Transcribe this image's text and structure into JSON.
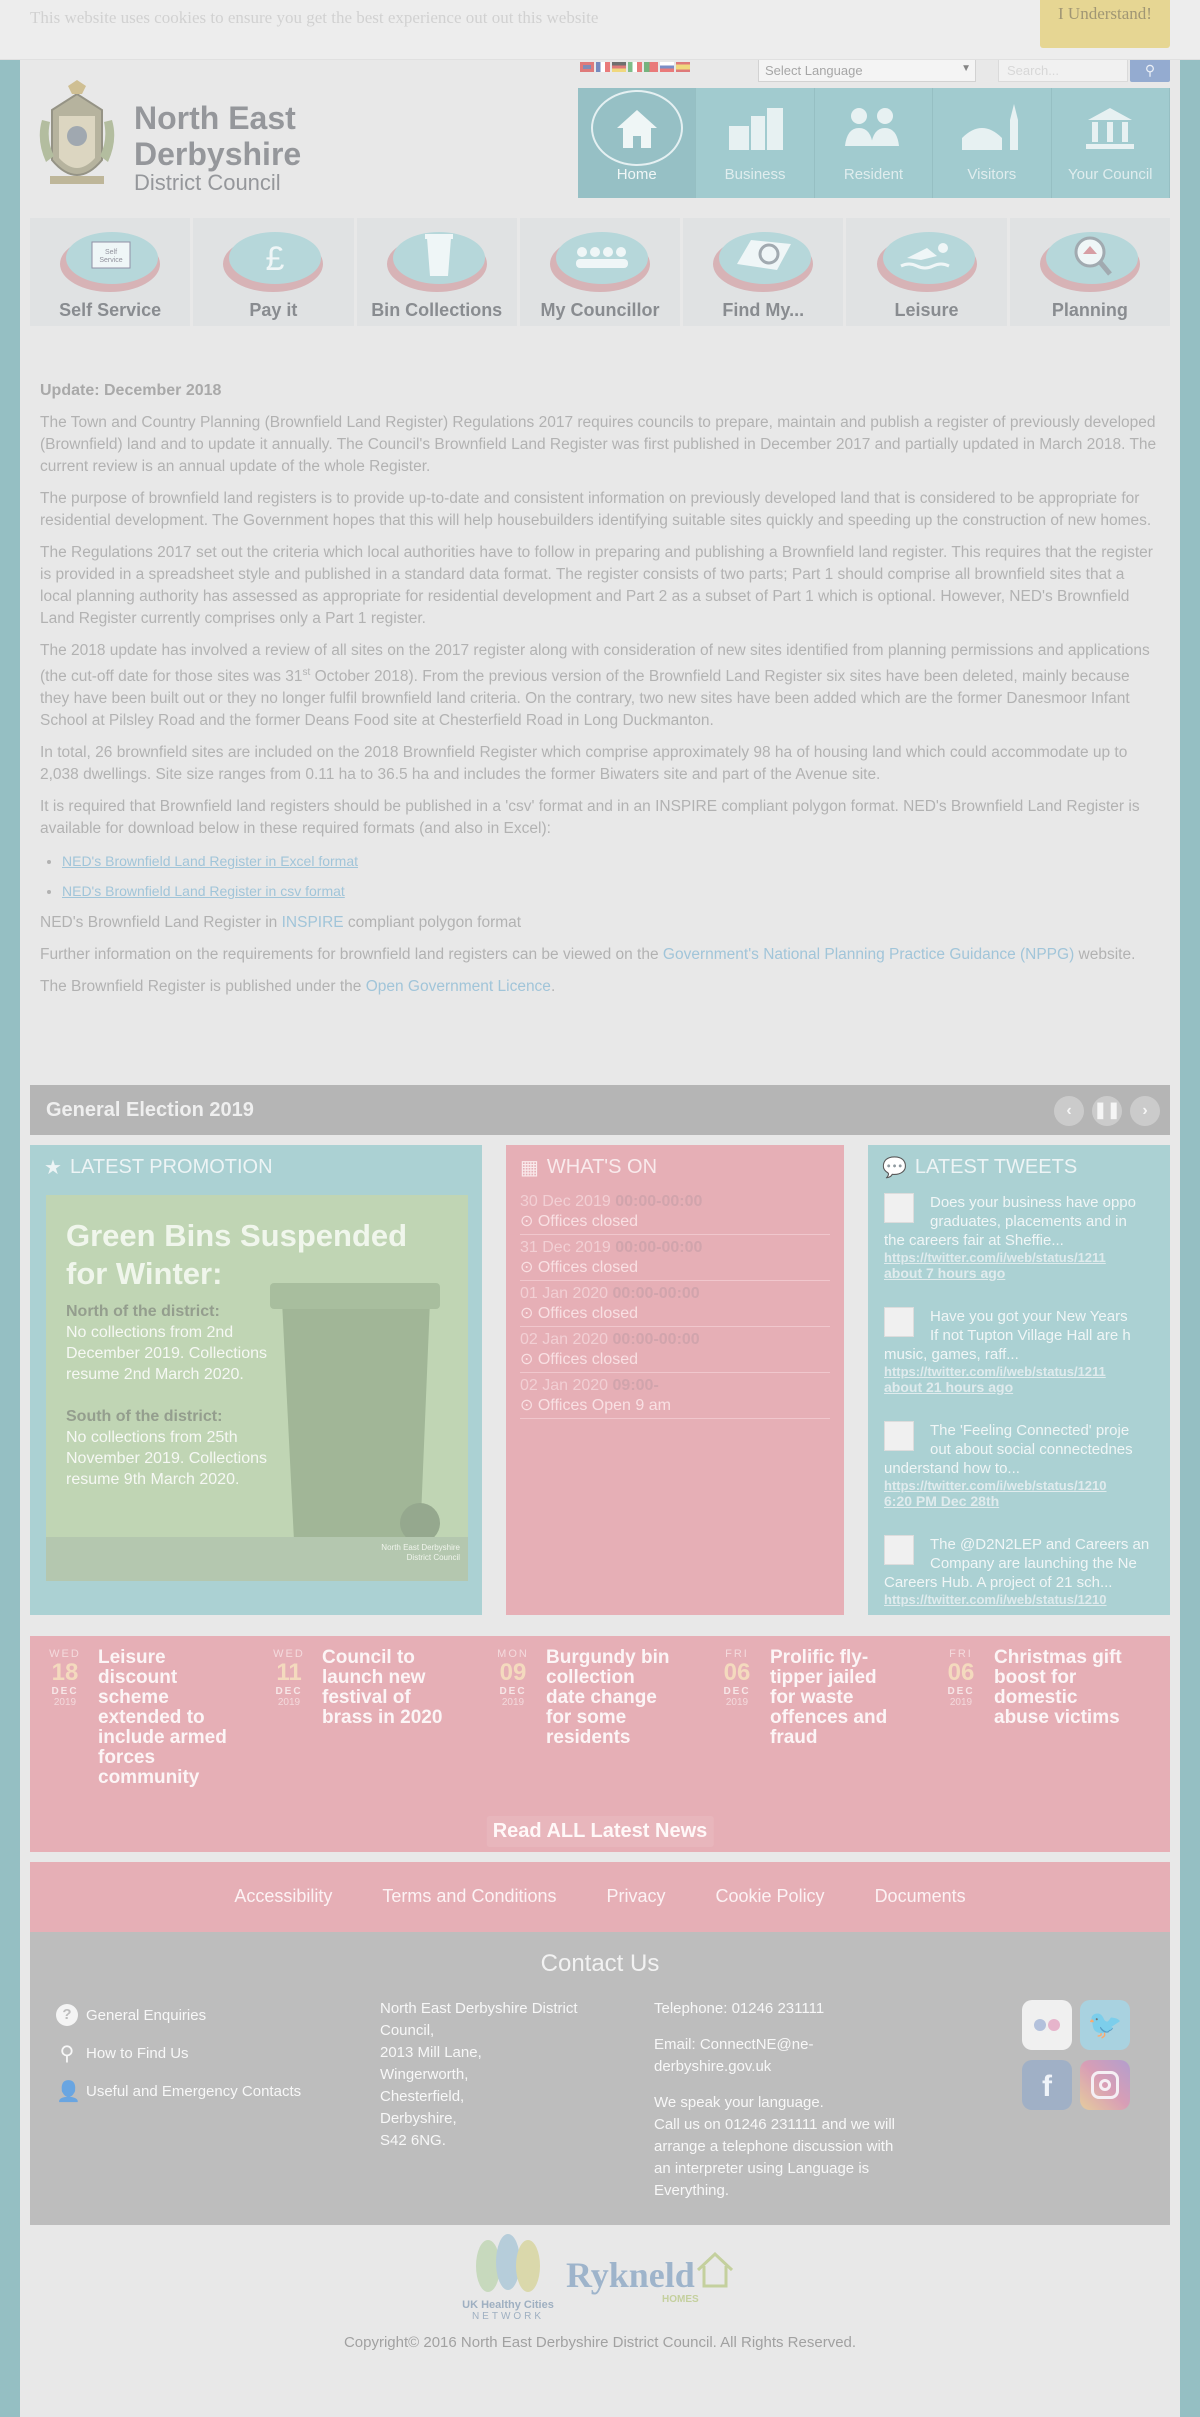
{
  "cookie": {
    "message": "This website uses cookies to ensure you get the best experience out out this website",
    "button": "I Understand!"
  },
  "utility": {
    "language_placeholder": "Select Language",
    "search_placeholder": "Search..."
  },
  "logo": {
    "name_line1": "North East",
    "name_line2": "Derbyshire",
    "subtitle": "District Council"
  },
  "main_nav": [
    {
      "label": "Home",
      "icon": "house-icon"
    },
    {
      "label": "Business",
      "icon": "buildings-icon"
    },
    {
      "label": "Resident",
      "icon": "people-icon"
    },
    {
      "label": "Visitors",
      "icon": "skyline-icon"
    },
    {
      "label": "Your Council",
      "icon": "bank-icon"
    }
  ],
  "quick_links": [
    {
      "label": "Self Service",
      "icon": "self-service-icon",
      "icon_text": "Self Service"
    },
    {
      "label": "Pay it",
      "icon": "pound-icon"
    },
    {
      "label": "Bin Collections",
      "icon": "bin-icon"
    },
    {
      "label": "My Councillor",
      "icon": "councillors-icon"
    },
    {
      "label": "Find My...",
      "icon": "map-search-icon"
    },
    {
      "label": "Leisure",
      "icon": "swimmer-icon"
    },
    {
      "label": "Planning",
      "icon": "house-magnifier-icon"
    }
  ],
  "article": {
    "heading": "Update: December 2018",
    "p1": "The Town and Country Planning (Brownfield Land Register) Regulations 2017 requires councils to prepare, maintain and publish a register of previously developed (Brownfield) land and to update it annually. The Council's Brownfield Land Register was first published in December 2017 and partially updated in March 2018. The current review is an annual update of the whole Register.",
    "p2": "The purpose of brownfield land registers is to provide up-to-date and consistent information on previously developed land that is considered to be appropriate for residential development. The Government hopes that this will help housebuilders identifying suitable sites quickly and speeding up the construction of new homes.",
    "p3": "The Regulations 2017 set out the criteria which local authorities have to follow in preparing and publishing a Brownfield land register. This requires that the register is provided in a spreadsheet style and published in a standard data format. The register consists of two parts; Part 1 should comprise all brownfield sites that a local planning authority has assessed as appropriate for residential development and Part 2 as a subset of Part 1 which is optional. However, NED's Brownfield Land Register currently comprises only a Part 1 register.",
    "p4a": "The 2018 update has involved a review of all sites on the 2017 register along with consideration of new sites identified from planning permissions and applications (the cut-off date for those sites was 31",
    "p4sup": "st",
    "p4b": " October 2018). From the previous version of the Brownfield Land Register six sites have been deleted, mainly because they have been built out or they no longer fulfil brownfield land criteria. On the contrary, two new sites have been added which are the former Danesmoor Infant School at Pilsley Road and the former Deans Food site at Chesterfield Road in Long Duckmanton.",
    "p5": "In total, 26 brownfield sites are included on the 2018 Brownfield Register which comprise approximately 98 ha of housing land which could accommodate up to 2,038 dwellings. Site size ranges from 0.11 ha to 36.5 ha and includes the former Biwaters site and part of the Avenue site.",
    "p6": "It is required that Brownfield land registers should be published in a 'csv' format and in an INSPIRE compliant polygon format. NED's Brownfield Land Register is available for download below in these required formats (and also in Excel):",
    "links": [
      "NED's Brownfield Land Register in Excel format",
      "NED's Brownfield Land Register in csv format"
    ],
    "p7a": "NED's Brownfield Land Register in ",
    "p7link": "INSPIRE",
    "p7b": " compliant polygon format",
    "p8a": "Further information on the requirements for brownfield land registers can be viewed on the ",
    "p8link": "Government's National Planning Practice Guidance (NPPG)",
    "p8b": " website.",
    "p9a": "The Brownfield Register is published under the ",
    "p9link": "Open Government Licence",
    "p9b": "."
  },
  "election": {
    "title": "General Election 2019"
  },
  "promotion": {
    "heading": "LATEST PROMOTION",
    "title": "Green Bins Suspended for Winter:",
    "north_label": "North of the district:",
    "north_text": "No collections from 2nd December 2019. Collections resume 2nd March 2020.",
    "south_label": "South of the district:",
    "south_text": "No collections from 25th November 2019. Collections resume 9th March 2020.",
    "badge": "North East Derbyshire District Council"
  },
  "whats_on": {
    "heading": "WHAT'S ON",
    "events": [
      {
        "date": "30 Dec 2019",
        "time": "00:00-00:00",
        "text": "Offices closed"
      },
      {
        "date": "31 Dec 2019",
        "time": "00:00-00:00",
        "text": "Offices closed"
      },
      {
        "date": "01 Jan 2020",
        "time": "00:00-00:00",
        "text": "Offices closed"
      },
      {
        "date": "02 Jan 2020",
        "time": "00:00-00:00",
        "text": "Offices closed"
      },
      {
        "date": "02 Jan 2020",
        "time": "09:00-",
        "text": "Offices Open 9 am"
      }
    ]
  },
  "tweets": {
    "heading": "LATEST TWEETS",
    "items": [
      {
        "text1": "Does your business have oppo",
        "text2": "graduates, placements and in",
        "text3": "the careers fair at Sheffie...",
        "link": "https://twitter.com/i/web/status/1211",
        "time": "about 7 hours ago"
      },
      {
        "text1": "Have you got your New Years",
        "text2": "If not Tupton Village Hall are h",
        "text3": "music, games, raff...",
        "link": "https://twitter.com/i/web/status/1211",
        "time": "about 21 hours ago"
      },
      {
        "text1": "The 'Feeling Connected' proje",
        "text2": "out about social connectednes",
        "text3": "understand how to...",
        "link": "https://twitter.com/i/web/status/1210",
        "time": "6:20 PM Dec 28th"
      },
      {
        "text1": "The @D2N2LEP and Careers an",
        "text2": "Company are launching the Ne",
        "text3": "Careers Hub. A project of 21 sch...",
        "link": "https://twitter.com/i/web/status/1210",
        "time": ""
      }
    ]
  },
  "news": [
    {
      "dow": "WED",
      "day": "18",
      "mon": "DEC",
      "year": "2019",
      "title": "Leisure discount scheme extended to include armed forces community"
    },
    {
      "dow": "WED",
      "day": "11",
      "mon": "DEC",
      "year": "2019",
      "title": "Council to launch new festival of brass in 2020"
    },
    {
      "dow": "MON",
      "day": "09",
      "mon": "DEC",
      "year": "2019",
      "title": "Burgundy bin collection date change for some residents"
    },
    {
      "dow": "FRI",
      "day": "06",
      "mon": "DEC",
      "year": "2019",
      "title": "Prolific fly-tipper jailed for waste offences and fraud"
    },
    {
      "dow": "FRI",
      "day": "06",
      "mon": "DEC",
      "year": "2019",
      "title": "Christmas gift boost for domestic abuse victims"
    }
  ],
  "read_all": "Read ALL Latest News",
  "footer_links": [
    "Accessibility",
    "Terms and Conditions",
    "Privacy",
    "Cookie Policy",
    "Documents"
  ],
  "contact": {
    "heading": "Contact Us",
    "links": [
      "General Enquiries",
      "How to Find Us",
      "Useful and Emergency Contacts"
    ],
    "address": [
      "North East Derbyshire District Council,",
      "2013 Mill Lane,",
      "Wingerworth,",
      "Chesterfield,",
      "Derbyshire,",
      "S42 6NG."
    ],
    "telephone": "Telephone:  01246 231111",
    "email": "Email:  ConnectNE@ne-derbyshire.gov.uk",
    "language1": "We speak your language.",
    "language2": "Call us on 01246 231111 and we will arrange a telephone discussion with an interpreter using Language is Everything."
  },
  "bottom_logos": {
    "ukhc1": "UK Healthy Cities",
    "ukhc2": "NETWORK",
    "rykneld": "Rykneld",
    "rykneld_sub": "HOMES"
  },
  "copyright": "Copyright© 2016 North East Derbyshire District Council. All Rights Reserved.",
  "colors": {
    "teal": "#6fb0b6",
    "pink": "#d98590",
    "grey_footer": "#9a9a9a",
    "cookie_button": "#d9c05a"
  }
}
